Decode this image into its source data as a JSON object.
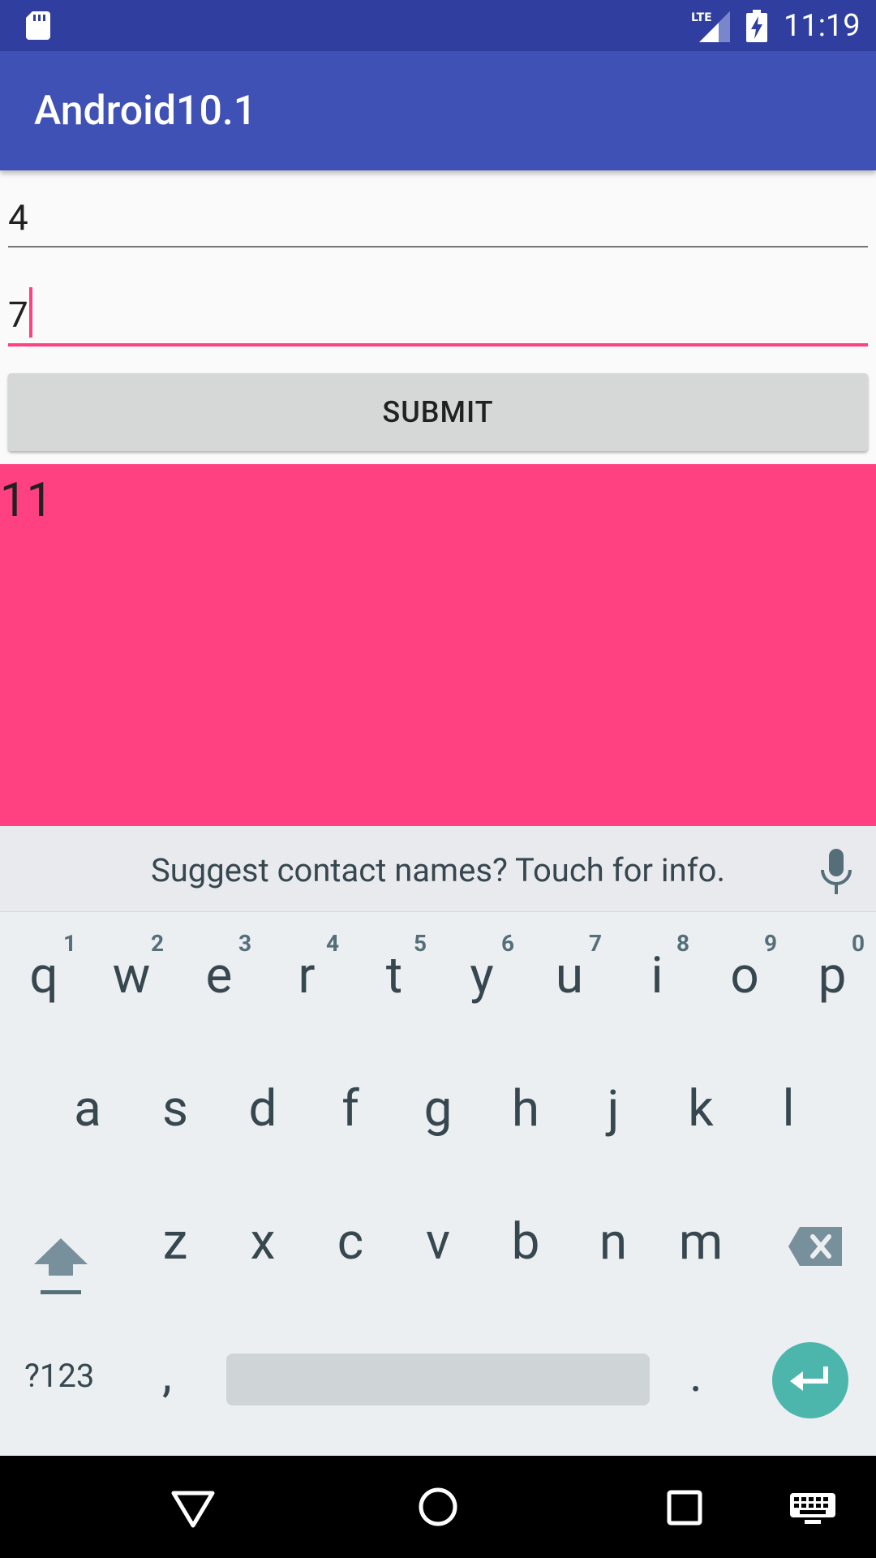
{
  "status_bar": {
    "time": "11:19",
    "network": "LTE",
    "icons": [
      "sd-card-icon",
      "lte-signal-icon",
      "battery-charging-icon"
    ]
  },
  "app_bar": {
    "title": "Android10.1"
  },
  "form": {
    "first_value": "4",
    "second_value": "7",
    "submit_label": "SUBMIT"
  },
  "result": {
    "value": "11"
  },
  "keyboard": {
    "suggestion": "Suggest contact names? Touch for info.",
    "row1": [
      {
        "letter": "q",
        "hint": "1"
      },
      {
        "letter": "w",
        "hint": "2"
      },
      {
        "letter": "e",
        "hint": "3"
      },
      {
        "letter": "r",
        "hint": "4"
      },
      {
        "letter": "t",
        "hint": "5"
      },
      {
        "letter": "y",
        "hint": "6"
      },
      {
        "letter": "u",
        "hint": "7"
      },
      {
        "letter": "i",
        "hint": "8"
      },
      {
        "letter": "o",
        "hint": "9"
      },
      {
        "letter": "p",
        "hint": "0"
      }
    ],
    "row2": [
      "a",
      "s",
      "d",
      "f",
      "g",
      "h",
      "j",
      "k",
      "l"
    ],
    "row3": [
      "z",
      "x",
      "c",
      "v",
      "b",
      "n",
      "m"
    ],
    "symbols_label": "?123",
    "comma": ",",
    "period": "."
  },
  "colors": {
    "status_bar": "#303f9f",
    "app_bar": "#3f51b5",
    "accent": "#ff4081",
    "enter_key": "#4db6ac"
  },
  "nav_bar": {
    "icons": [
      "back-icon",
      "home-icon",
      "recents-icon",
      "keyboard-switch-icon"
    ]
  }
}
